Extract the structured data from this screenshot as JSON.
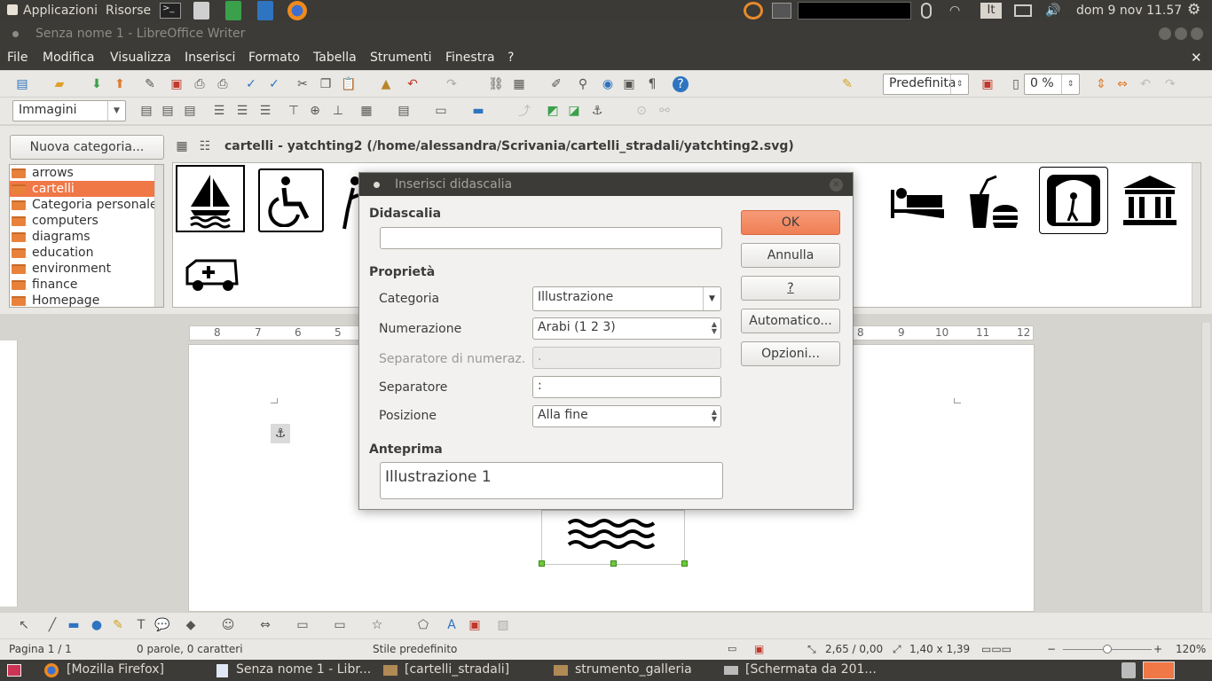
{
  "topbar": {
    "apps": "Applicazioni",
    "places": "Risorse",
    "keyboard_layout": "It",
    "clock": "dom  9 nov 11.57"
  },
  "window_title": "Senza nome 1 - LibreOffice Writer",
  "menu": [
    "File",
    "Modifica",
    "Visualizza",
    "Inserisci",
    "Formato",
    "Tabella",
    "Strumenti",
    "Finestra",
    "?"
  ],
  "toolbar": {
    "style_value": "Predefinita",
    "transparency_value": "0 %",
    "frame_style_value": "Immagini"
  },
  "gallery": {
    "new_category_label": "Nuova categoria...",
    "path_label": "cartelli - yatchting2 (/home/alessandra/Scrivania/cartelli_stradali/yatchting2.svg)",
    "categories": [
      "arrows",
      "cartelli",
      "Categoria personale",
      "computers",
      "diagrams",
      "education",
      "environment",
      "finance",
      "Homepage"
    ],
    "selected_category": "cartelli"
  },
  "ruler_ticks": [
    "8",
    "7",
    "6",
    "5",
    "8",
    "9",
    "10",
    "11",
    "12"
  ],
  "dialog": {
    "title": "Inserisci didascalia",
    "caption_section": "Didascalia",
    "caption_value": "",
    "properties_section": "Proprietà",
    "category_label": "Categoria",
    "category_value": "Illustrazione",
    "numbering_label": "Numerazione",
    "numbering_value": "Arabi (1 2 3)",
    "num_separator_label": "Separatore di numeraz.",
    "num_separator_value": ".",
    "separator_label": "Separatore",
    "separator_value": ":",
    "position_label": "Posizione",
    "position_value": "Alla fine",
    "preview_section": "Anteprima",
    "preview_value": "Illustrazione 1",
    "ok_label": "OK",
    "cancel_label": "Annulla",
    "help_label": "?",
    "auto_label": "Automatico...",
    "options_label": "Opzioni..."
  },
  "statusbar": {
    "page": "Pagina 1 / 1",
    "words": "0 parole, 0 caratteri",
    "page_style": "Stile predefinito",
    "position": "2,65 / 0,00",
    "size": "1,40 x 1,39",
    "zoom": "120%"
  },
  "taskbar": [
    "[Mozilla Firefox]",
    "Senza nome 1 - Libr...",
    "[cartelli_stradali]",
    "strumento_galleria",
    "[Schermata da 201..."
  ],
  "colors": {
    "accent": "#f07746",
    "panel_dark": "#3c3b37",
    "toolbar_bg": "#e9e8e4"
  }
}
